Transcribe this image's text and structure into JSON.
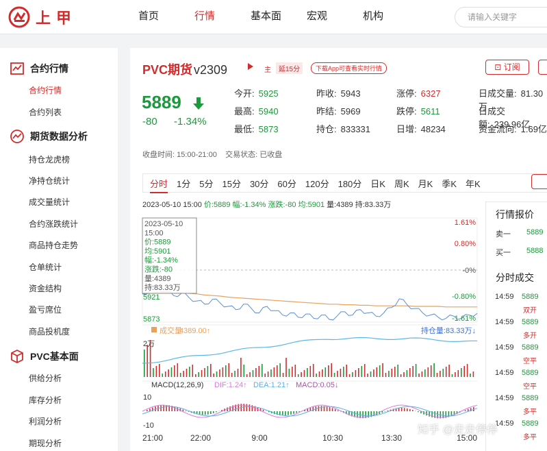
{
  "brand": {
    "logo_text": "上甲"
  },
  "nav": {
    "items": [
      "首页",
      "行情",
      "基本面",
      "宏观",
      "机构"
    ],
    "active": 1,
    "search_placeholder": "请输入关键字"
  },
  "sidebar": {
    "group1": "合约行情",
    "group1_items": [
      "合约行情",
      "合约列表"
    ],
    "group2": "期货数据分析",
    "group2_items": [
      "持仓龙虎榜",
      "净持仓统计",
      "成交量统计",
      "合约涨跌统计",
      "商品持仓走势",
      "仓单统计",
      "资金结构",
      "盈亏席位",
      "商品投机度"
    ],
    "group3": "PVC基本面",
    "group3_items": [
      "供给分析",
      "库存分析",
      "利润分析",
      "期现分析"
    ]
  },
  "header": {
    "name": "PVC期货",
    "code": "v2309",
    "main_badge": "主",
    "delay_badge": "延15分",
    "download": "下载App可查看实时行情",
    "subscribe": "订阅"
  },
  "quote": {
    "price": "5889",
    "change": "-80",
    "change_pct": "-1.34%",
    "stats": [
      {
        "label": "今开:",
        "value": "5925",
        "color": "green"
      },
      {
        "label": "昨收:",
        "value": "5943",
        "color": "dark"
      },
      {
        "label": "涨停:",
        "value": "6327",
        "color": "red"
      },
      {
        "label": "日成交量:",
        "value": "81.30万",
        "color": "dark"
      },
      {
        "label": "最高:",
        "value": "5940",
        "color": "green"
      },
      {
        "label": "昨结:",
        "value": "5969",
        "color": "dark"
      },
      {
        "label": "跌停:",
        "value": "5611",
        "color": "green"
      },
      {
        "label": "日成交额:",
        "value": "239.96亿",
        "color": "dark"
      },
      {
        "label": "最低:",
        "value": "5873",
        "color": "green"
      },
      {
        "label": "持仓:",
        "value": "833331",
        "color": "dark"
      },
      {
        "label": "日增:",
        "value": "48234",
        "color": "dark"
      },
      {
        "label": "资金流向:",
        "value": "1.69亿",
        "color": "dark"
      }
    ],
    "time_label": "收盘时间:",
    "time_value": "15:00-21:00",
    "status_label": "交易状态:",
    "status_value": "已收盘"
  },
  "tabs": [
    "分时",
    "1分",
    "5分",
    "15分",
    "30分",
    "60分",
    "120分",
    "180分",
    "日K",
    "周K",
    "月K",
    "季K",
    "年K"
  ],
  "chart_head": {
    "datetime": "2023-05-10 15:00",
    "price": "价:5889",
    "amp": "幅:-1.34%",
    "change": "涨跌:-80",
    "avg": "均:5901",
    "volume": "量:4389",
    "hold": "持:83.33万"
  },
  "tooltip": [
    "2023-05-10",
    "15:00",
    "价:5889",
    "均:5901",
    "幅:-1.34%",
    "涨跌:-80",
    "量:4389",
    "持:83.33万"
  ],
  "chart_data": {
    "type": "line",
    "price_axis_right": [
      "1.61%",
      "0.80%",
      "-0%",
      "-0.80%",
      "-1.61%"
    ],
    "price_axis_left": [
      "5921",
      "5873"
    ],
    "x_ticks": [
      "21:00",
      "22:00",
      "9:00",
      "10:30",
      "13:30",
      "15:00"
    ],
    "volume_label": "成交量",
    "volume_value": "4389.00↑",
    "hold_label": "持仓量:83.33万↓",
    "volume_axis": "2万",
    "macd_label": "MACD(12,26,9)",
    "dif": "DIF:1.24↑",
    "dea": "DEA:1.21↑",
    "macd": "MACD:0.05↓",
    "macd_axis": [
      "10",
      "-10"
    ],
    "series": [
      {
        "name": "价",
        "values": [
          5925,
          5932,
          5936,
          5930,
          5922,
          5926,
          5918,
          5912,
          5906,
          5915,
          5908,
          5902,
          5896,
          5906,
          5898,
          5890,
          5902,
          5894,
          5886,
          5890,
          5882,
          5888,
          5880,
          5886,
          5878,
          5884,
          5892,
          5886,
          5896,
          5890,
          5884,
          5890,
          5900,
          5916,
          5905,
          5898,
          5890,
          5886,
          5882,
          5880,
          5884,
          5880,
          5886,
          5889
        ]
      },
      {
        "name": "均",
        "values": [
          5925,
          5926,
          5928,
          5928,
          5927,
          5927,
          5926,
          5925,
          5923,
          5922,
          5921,
          5919,
          5918,
          5917,
          5916,
          5915,
          5914,
          5913,
          5912,
          5911,
          5910,
          5909,
          5908,
          5907,
          5906,
          5906,
          5905,
          5905,
          5904,
          5904,
          5903,
          5903,
          5903,
          5903,
          5903,
          5902,
          5902,
          5902,
          5902,
          5901,
          5901,
          5901,
          5901,
          5901
        ]
      }
    ]
  },
  "quote_panel": {
    "title": "行情报价",
    "rows": [
      {
        "label": "卖一",
        "value": "5889"
      },
      {
        "label": "买一",
        "value": "5888"
      }
    ],
    "trades_title": "分时成交",
    "trades": [
      {
        "time": "14:59",
        "price": "5889",
        "type": "双开"
      },
      {
        "time": "14:59",
        "price": "5889",
        "type": "多开"
      },
      {
        "time": "14:59",
        "price": "5889",
        "type": "空平"
      },
      {
        "time": "14:59",
        "price": "5889",
        "type": "空平"
      },
      {
        "time": "14:59",
        "price": "5889",
        "type": "多平"
      },
      {
        "time": "14:59",
        "price": "5889",
        "type": "多平"
      }
    ]
  },
  "watermark": "知乎 @走走停停"
}
